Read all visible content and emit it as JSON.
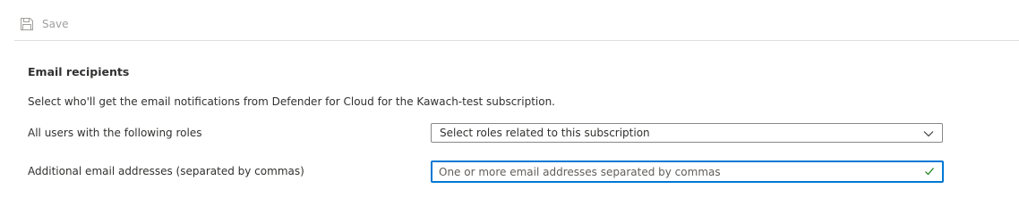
{
  "toolbar": {
    "save_label": "Save",
    "save_icon": "floppy-disk-icon",
    "save_disabled": true
  },
  "section": {
    "title": "Email recipients",
    "description": "Select who'll get the email notifications from Defender for Cloud for the Kawach-test subscription."
  },
  "fields": {
    "roles": {
      "label": "All users with the following roles",
      "value": "Select roles related to this subscription",
      "icon": "chevron-down-icon"
    },
    "emails": {
      "label": "Additional email addresses (separated by commas)",
      "value": "",
      "placeholder": "One or more email addresses separated by commas",
      "icon": "checkmark-icon"
    }
  },
  "colors": {
    "accent": "#0078d4",
    "success": "#107c10",
    "disabled_text": "#a19f9d",
    "text": "#323130",
    "border": "#8a8886"
  }
}
